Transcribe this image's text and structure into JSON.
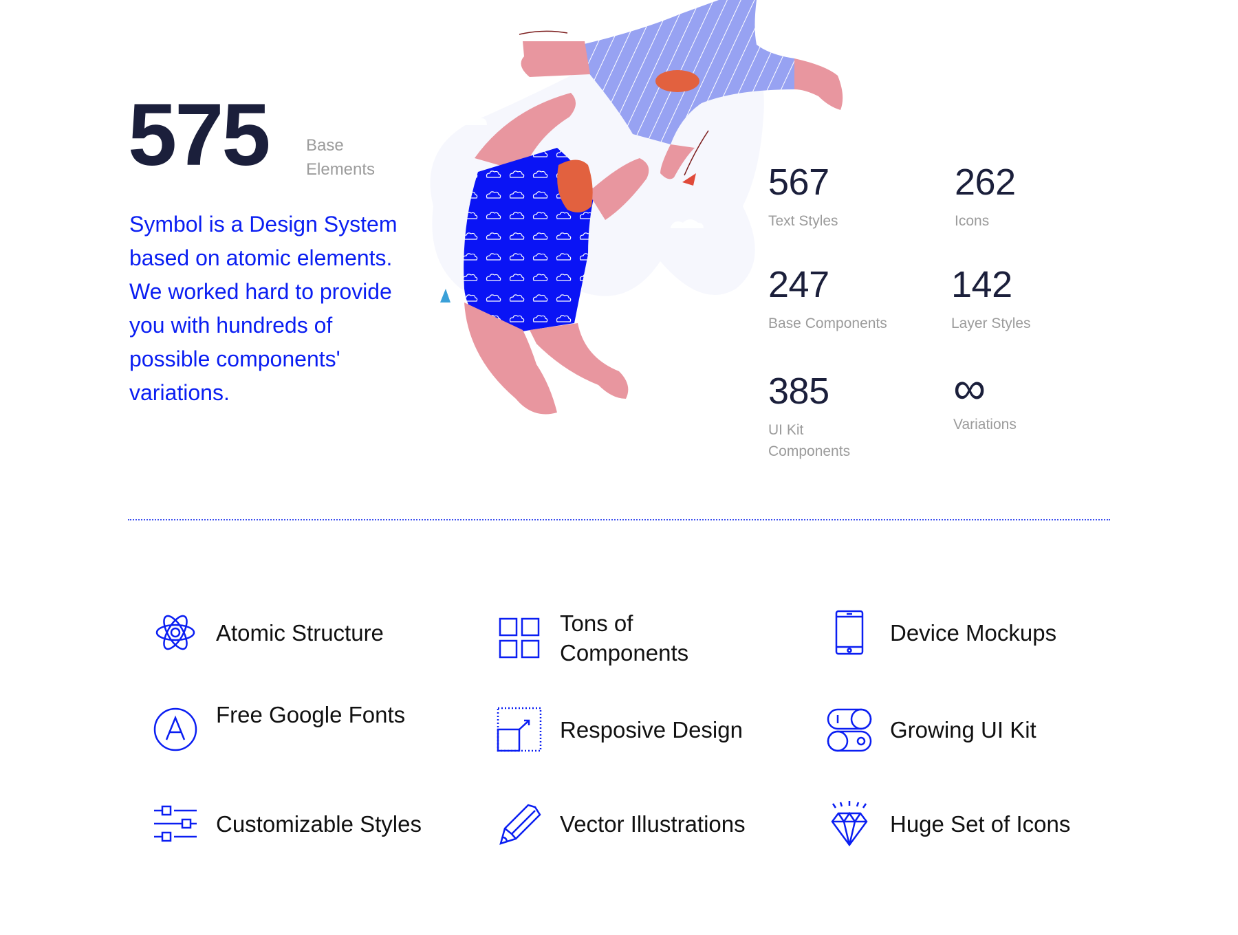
{
  "hero": {
    "big_number": "575",
    "big_label_line1": "Base",
    "big_label_line2": "Elements",
    "intro": "Symbol is a Design System based on atomic elements. We worked hard to provide you with hundreds of possible components' variations."
  },
  "illustration": {
    "description": "two-people-floating-illustration",
    "colors": {
      "skin": "#e8969f",
      "dress": "#0a14f5",
      "shirt": "#97a2f2",
      "hair": "#e2613f",
      "cloud_bg": "#f6f7fd"
    }
  },
  "stats": [
    {
      "value": "567",
      "label": "Text Styles"
    },
    {
      "value": "262",
      "label": "Icons"
    },
    {
      "value": "247",
      "label": "Base Components"
    },
    {
      "value": "142",
      "label": "Layer Styles"
    },
    {
      "value": "385",
      "label": "UI Kit Components"
    },
    {
      "value": "∞",
      "label": "Variations"
    }
  ],
  "features": [
    {
      "icon": "atom-icon",
      "label": "Atomic Structure"
    },
    {
      "icon": "grid-icon",
      "label": "Tons of Components"
    },
    {
      "icon": "phone-icon",
      "label": "Device Mockups"
    },
    {
      "icon": "font-a-icon",
      "label": "Free Google Fonts"
    },
    {
      "icon": "resize-icon",
      "label": "Resposive Design"
    },
    {
      "icon": "toggle-icon",
      "label": "Growing UI Kit"
    },
    {
      "icon": "sliders-icon",
      "label": "Customizable Styles"
    },
    {
      "icon": "pencil-icon",
      "label": "Vector Illustrations"
    },
    {
      "icon": "diamond-icon",
      "label": "Huge Set of Icons"
    }
  ],
  "colors": {
    "accent": "#0a1ef2",
    "heading": "#1b1f3b",
    "muted": "#9b9b9b",
    "text": "#111111"
  }
}
